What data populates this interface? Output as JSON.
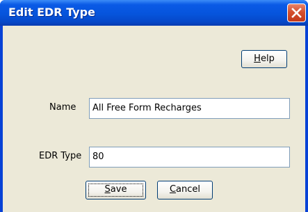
{
  "window": {
    "title": "Edit EDR Type"
  },
  "buttons": {
    "help": {
      "mnemonic": "H",
      "rest": "elp"
    },
    "save": {
      "mnemonic": "S",
      "rest": "ave"
    },
    "cancel": {
      "mnemonic": "C",
      "rest": "ancel"
    }
  },
  "form": {
    "name_label": "Name",
    "name_value": "All Free Form Recharges",
    "edr_type_label": "EDR Type",
    "edr_type_value": "80"
  },
  "icons": {
    "close": "close-icon"
  }
}
